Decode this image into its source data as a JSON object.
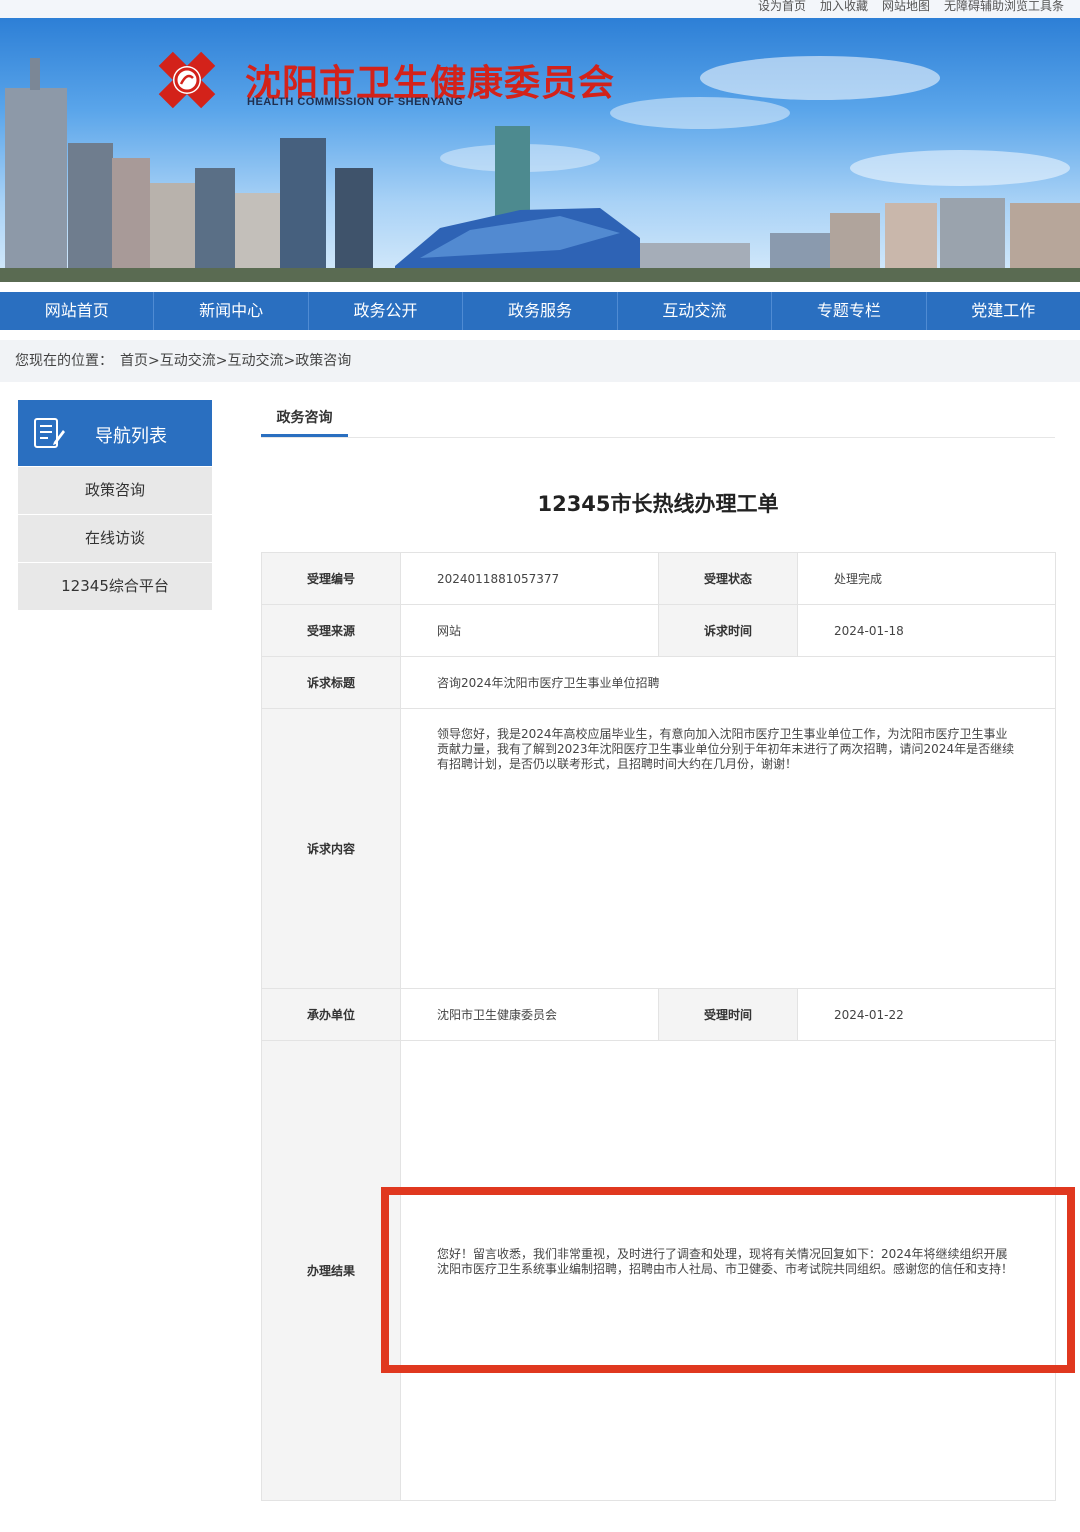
{
  "util_links": [
    "设为首页",
    "加入收藏",
    "网站地图",
    "无障碍辅助浏览工具条"
  ],
  "site": {
    "name_cn": "沈阳市卫生健康委员会",
    "name_en": "HEALTH COMMISSION OF SHENYANG"
  },
  "nav": [
    "网站首页",
    "新闻中心",
    "政务公开",
    "政务服务",
    "互动交流",
    "专题专栏",
    "党建工作"
  ],
  "breadcrumb": {
    "label": "您现在的位置：",
    "items": [
      "首页",
      "互动交流",
      "互动交流",
      "政策咨询"
    ],
    "separator": ">"
  },
  "sidebar": {
    "title": "导航列表",
    "items": [
      "政策咨询",
      "在线访谈",
      "12345综合平台"
    ]
  },
  "tab": "政务咨询",
  "doc_title": "12345市长热线办理工单",
  "ticket": {
    "id_label": "受理编号",
    "id_value": "2024011881057377",
    "status_label": "受理状态",
    "status_value": "处理完成",
    "source_label": "受理来源",
    "source_value": "网站",
    "appeal_time_label": "诉求时间",
    "appeal_time_value": "2024-01-18",
    "subject_label": "诉求标题",
    "subject_value": "咨询2024年沈阳市医疗卫生事业单位招聘",
    "content_label": "诉求内容",
    "content_value": "领导您好，我是2024年高校应届毕业生，有意向加入沈阳市医疗卫生事业单位工作，为沈阳市医疗卫生事业贡献力量，我有了解到2023年沈阳医疗卫生事业单位分别于年初年末进行了两次招聘，请问2024年是否继续有招聘计划，是否仍以联考形式，且招聘时间大约在几月份，谢谢！",
    "dept_label": "承办单位",
    "dept_value": "沈阳市卫生健康委员会",
    "accept_time_label": "受理时间",
    "accept_time_value": "2024-01-22",
    "result_label": "办理结果",
    "result_value": "您好！留言收悉，我们非常重视，及时进行了调查和处理，现将有关情况回复如下：2024年将继续组织开展沈阳市医疗卫生系统事业编制招聘，招聘由市人社局、市卫健委、市考试院共同组织。感谢您的信任和支持！"
  },
  "colors": {
    "primary_blue": "#2a6fc0",
    "logo_red": "#d3221a",
    "highlight_red": "#e0381f"
  }
}
